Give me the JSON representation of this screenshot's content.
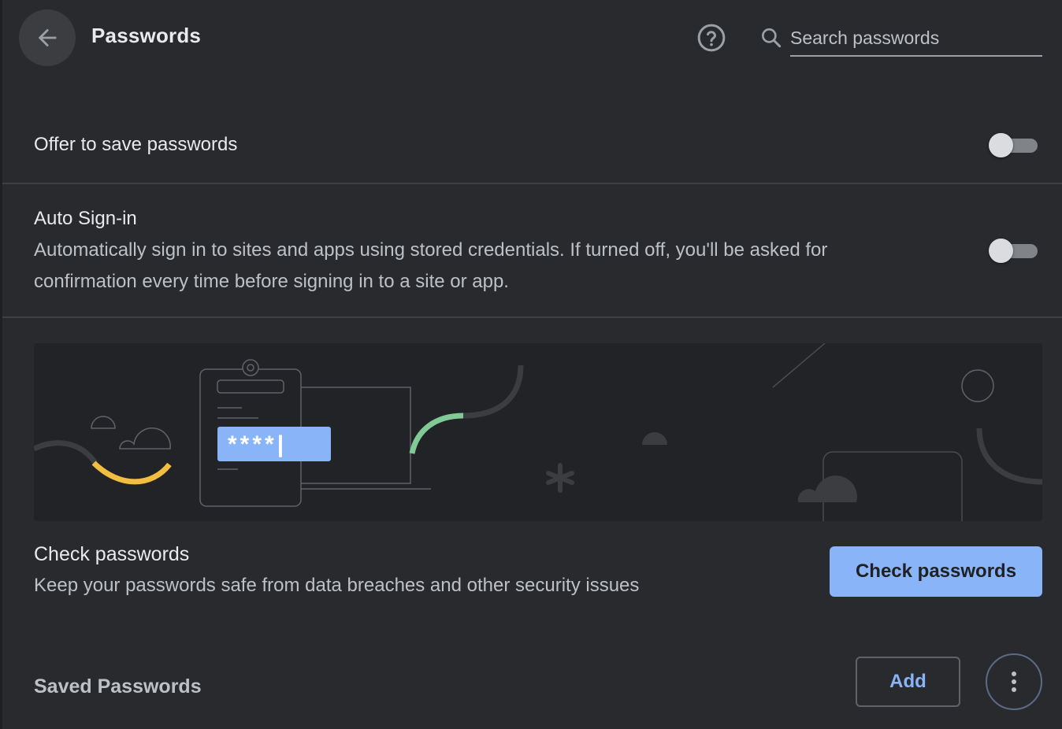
{
  "header": {
    "back_icon": "arrow-left-icon",
    "title": "Passwords",
    "help_icon": "help-circle-icon",
    "search_icon": "search-icon",
    "search_placeholder": "Search passwords",
    "search_value": ""
  },
  "settings": {
    "offer_to_save": {
      "label": "Offer to save passwords",
      "enabled": false
    },
    "auto_sign_in": {
      "label": "Auto Sign-in",
      "description": "Automatically sign in to sites and apps using stored credentials. If turned off, you'll be asked for confirmation every time before signing in to a site or app.",
      "enabled": false
    }
  },
  "banner": {
    "password_field_text": "****|"
  },
  "check_passwords": {
    "title": "Check passwords",
    "description": "Keep your passwords safe from data breaches and other security issues",
    "button_label": "Check passwords"
  },
  "saved_passwords": {
    "title": "Saved Passwords",
    "add_label": "Add",
    "more_icon": "more-vertical-icon"
  },
  "colors": {
    "background": "#292a2d",
    "accent": "#8ab4f8",
    "text_primary": "#e8eaed",
    "text_secondary": "#bdc1c6",
    "illustration_yellow": "#f2be42",
    "illustration_green": "#81c995"
  }
}
